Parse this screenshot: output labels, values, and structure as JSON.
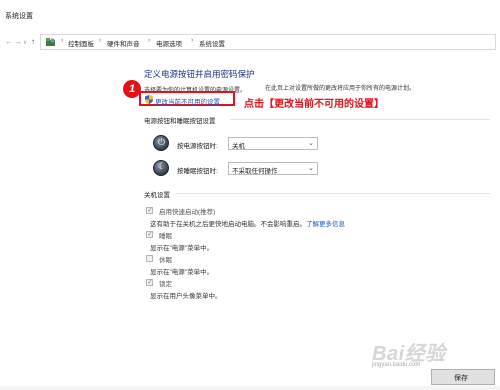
{
  "window": {
    "title": "系统设置"
  },
  "nav": {
    "back": "←",
    "forward": "→",
    "dropdown": "∨",
    "up": "↑"
  },
  "breadcrumb": {
    "separator": "›",
    "items": [
      "控制面板",
      "硬件和声音",
      "电源选项",
      "系统设置"
    ]
  },
  "main": {
    "heading": "定义电源按钮并启用密码保护",
    "intro_left": "选择要为你的计算机设置的电源设置。",
    "intro_right": "在此页上对设置所做的更改将应用于你所有的电源计划。",
    "change_link": "更改当前不可用的设置"
  },
  "annotation": {
    "step_number": "1",
    "text": "点击【更改当前不可用的设置】",
    "color": "#e3121a"
  },
  "power_buttons": {
    "section_title": "电源按钮和睡眠按钮设置",
    "rows": [
      {
        "label": "按电源按钮时:",
        "value": "关机"
      },
      {
        "label": "按睡眠按钮时:",
        "value": "不采取任何操作"
      }
    ]
  },
  "shutdown": {
    "section_title": "关机设置",
    "options": [
      {
        "label": "启用快速启动(推荐)",
        "checked": true,
        "description": "这有助于在关机之后更快地启动电脑。不会影响重启。",
        "more_link": "了解更多信息"
      },
      {
        "label": "睡眠",
        "checked": true,
        "description": "显示在\"电源\"菜单中。"
      },
      {
        "label": "休眠",
        "checked": false,
        "description": "显示在\"电源\"菜单中。"
      },
      {
        "label": "锁定",
        "checked": true,
        "description": "显示在用户头像菜单中。"
      }
    ]
  },
  "watermark": {
    "text": "Bai经验",
    "sub": "jingyan.baidu.com"
  },
  "footer": {
    "save_label": "保存"
  }
}
